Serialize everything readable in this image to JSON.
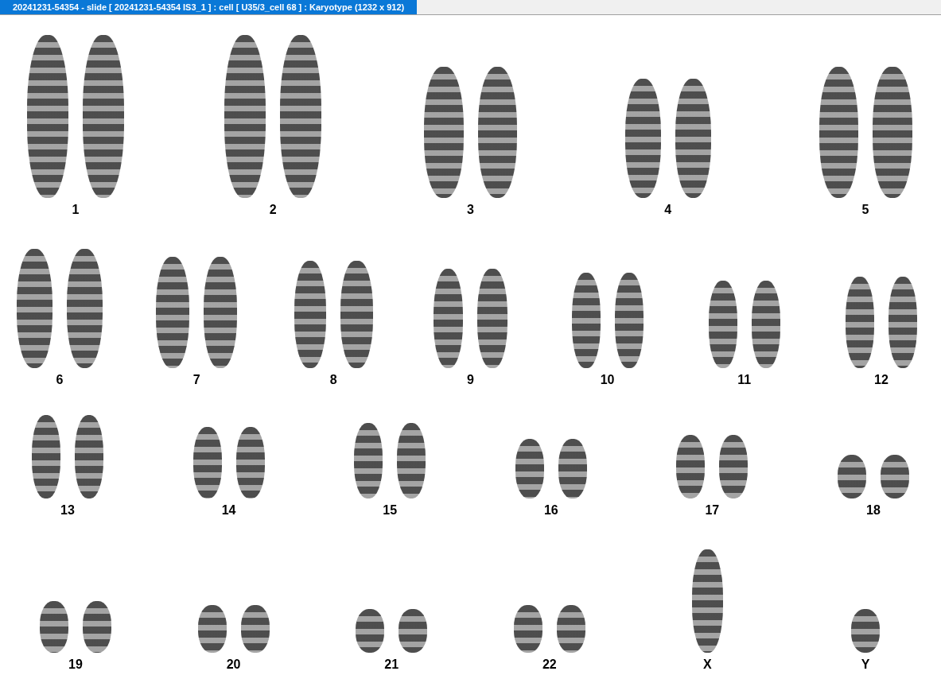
{
  "window": {
    "title": "20241231-54354 - slide [ 20241231-54354 IS3_1 ] : cell [ U35/3_cell 68 ] : Karyotype  (1232 x 912)"
  },
  "karyogram": {
    "rows": [
      {
        "groups": [
          {
            "label": "1",
            "kind": "pair"
          },
          {
            "label": "2",
            "kind": "pair"
          },
          {
            "label": "3",
            "kind": "pair"
          },
          {
            "label": "4",
            "kind": "pair"
          },
          {
            "label": "5",
            "kind": "pair"
          }
        ]
      },
      {
        "groups": [
          {
            "label": "6",
            "kind": "pair"
          },
          {
            "label": "7",
            "kind": "pair"
          },
          {
            "label": "8",
            "kind": "pair"
          },
          {
            "label": "9",
            "kind": "pair"
          },
          {
            "label": "10",
            "kind": "pair"
          },
          {
            "label": "11",
            "kind": "pair"
          },
          {
            "label": "12",
            "kind": "pair"
          }
        ]
      },
      {
        "groups": [
          {
            "label": "13",
            "kind": "pair"
          },
          {
            "label": "14",
            "kind": "pair"
          },
          {
            "label": "15",
            "kind": "pair"
          },
          {
            "label": "16",
            "kind": "pair"
          },
          {
            "label": "17",
            "kind": "pair"
          },
          {
            "label": "18",
            "kind": "pair"
          }
        ]
      },
      {
        "groups": [
          {
            "label": "19",
            "kind": "pair"
          },
          {
            "label": "20",
            "kind": "pair"
          },
          {
            "label": "21",
            "kind": "pair"
          },
          {
            "label": "22",
            "kind": "pair"
          },
          {
            "label": "X",
            "kind": "single"
          },
          {
            "label": "Y",
            "kind": "single"
          }
        ]
      }
    ]
  }
}
